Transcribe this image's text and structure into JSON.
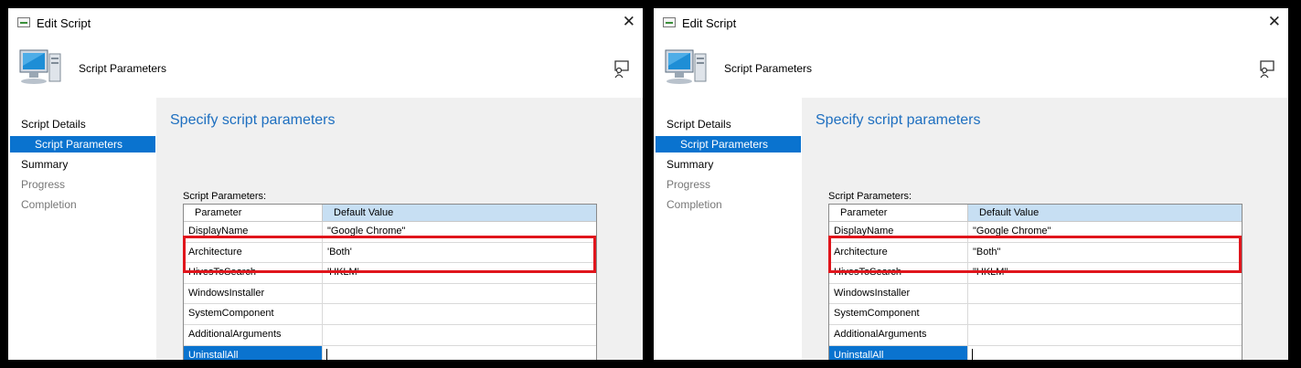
{
  "panels": [
    {
      "window_title": "Edit Script",
      "header_title": "Script Parameters",
      "nav": [
        {
          "label": "Script Details"
        },
        {
          "label": "Script Parameters"
        },
        {
          "label": "Summary"
        },
        {
          "label": "Progress"
        },
        {
          "label": "Completion"
        }
      ],
      "content_title": "Specify script parameters",
      "params_label": "Script Parameters:",
      "columns": {
        "parameter": "Parameter",
        "default_value": "Default Value"
      },
      "rows": [
        {
          "name": "DisplayName",
          "value": "\"Google Chrome\""
        },
        {
          "name": "Architecture",
          "value": "'Both'"
        },
        {
          "name": "HivesToSearch",
          "value": "'HKLM'"
        },
        {
          "name": "WindowsInstaller",
          "value": ""
        },
        {
          "name": "SystemComponent",
          "value": ""
        },
        {
          "name": "AdditionalArguments",
          "value": ""
        },
        {
          "name": "UninstallAll",
          "value": ""
        }
      ]
    },
    {
      "window_title": "Edit Script",
      "header_title": "Script Parameters",
      "nav": [
        {
          "label": "Script Details"
        },
        {
          "label": "Script Parameters"
        },
        {
          "label": "Summary"
        },
        {
          "label": "Progress"
        },
        {
          "label": "Completion"
        }
      ],
      "content_title": "Specify script parameters",
      "params_label": "Script Parameters:",
      "columns": {
        "parameter": "Parameter",
        "default_value": "Default Value"
      },
      "rows": [
        {
          "name": "DisplayName",
          "value": "\"Google Chrome\""
        },
        {
          "name": "Architecture",
          "value": "\"Both\""
        },
        {
          "name": "HivesToSearch",
          "value": "\"HKLM\""
        },
        {
          "name": "WindowsInstaller",
          "value": ""
        },
        {
          "name": "SystemComponent",
          "value": ""
        },
        {
          "name": "AdditionalArguments",
          "value": ""
        },
        {
          "name": "UninstallAll",
          "value": ""
        }
      ]
    }
  ],
  "colors": {
    "accent": "#0a73cf",
    "title_blue": "#1e6fc0",
    "highlight": "#e0151c",
    "header_cell": "#c7dff3"
  },
  "icons": [
    "script-window-icon",
    "close-icon",
    "computer-icon",
    "help-icon"
  ]
}
